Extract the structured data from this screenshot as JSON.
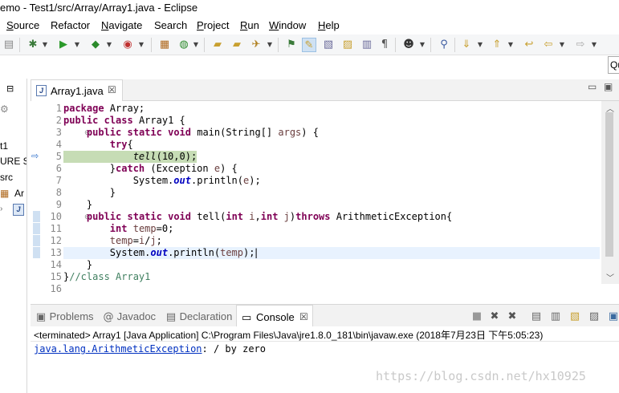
{
  "window": {
    "title": "emo - Test1/src/Array/Array1.java - Eclipse"
  },
  "menu": [
    {
      "mnemonic": "S",
      "rest": "ource"
    },
    {
      "mnemonic": "",
      "rest": "Refactor"
    },
    {
      "mnemonic": "N",
      "rest": "avigate"
    },
    {
      "mnemonic": "",
      "rest": "Search"
    },
    {
      "mnemonic": "P",
      "rest": "roject"
    },
    {
      "mnemonic": "R",
      "rest": "un"
    },
    {
      "mnemonic": "W",
      "rest": "indow"
    },
    {
      "mnemonic": "H",
      "rest": "elp"
    }
  ],
  "quick_access": {
    "label": "Qu"
  },
  "left_pane": {
    "items": [
      "t1",
      "URE S",
      "src",
      "Ar"
    ]
  },
  "editor": {
    "tab_label": "Array1.java",
    "tab_icon": "J",
    "close_glyph": "☒",
    "line_numbers": [
      "1",
      "2",
      "3",
      "4",
      "5",
      "6",
      "7",
      "8",
      "9",
      "10",
      "11",
      "12",
      "13",
      "14",
      "15",
      "16"
    ],
    "fold_marks": {
      "3": "⊖",
      "10": "⊖"
    },
    "lines": [
      [
        {
          "t": "package",
          "c": "kw"
        },
        {
          "t": " Array;"
        }
      ],
      [
        {
          "t": "public",
          "c": "kw"
        },
        {
          "t": " "
        },
        {
          "t": "class",
          "c": "kw"
        },
        {
          "t": " Array1 {"
        }
      ],
      [
        {
          "t": "    "
        },
        {
          "t": "public",
          "c": "kw"
        },
        {
          "t": " "
        },
        {
          "t": "static",
          "c": "kw"
        },
        {
          "t": " "
        },
        {
          "t": "void",
          "c": "kw"
        },
        {
          "t": " main(String[] "
        },
        {
          "t": "args",
          "c": "var"
        },
        {
          "t": ") {"
        }
      ],
      [
        {
          "t": "        "
        },
        {
          "t": "try",
          "c": "kw"
        },
        {
          "t": "{"
        }
      ],
      [
        {
          "t": "            "
        },
        {
          "t": "tell",
          "c": "it"
        },
        {
          "t": "(10,0);"
        }
      ],
      [
        {
          "t": "        }"
        },
        {
          "t": "catch",
          "c": "kw"
        },
        {
          "t": " (Exception "
        },
        {
          "t": "e",
          "c": "var"
        },
        {
          "t": ") {"
        }
      ],
      [
        {
          "t": "            System."
        },
        {
          "t": "out",
          "c": "fld"
        },
        {
          "t": ".println("
        },
        {
          "t": "e",
          "c": "var"
        },
        {
          "t": ");"
        }
      ],
      [
        {
          "t": "        }"
        }
      ],
      [
        {
          "t": "    }"
        }
      ],
      [
        {
          "t": "    "
        },
        {
          "t": "public",
          "c": "kw"
        },
        {
          "t": " "
        },
        {
          "t": "static",
          "c": "kw"
        },
        {
          "t": " "
        },
        {
          "t": "void",
          "c": "kw"
        },
        {
          "t": " tell("
        },
        {
          "t": "int",
          "c": "kw"
        },
        {
          "t": " "
        },
        {
          "t": "i",
          "c": "var"
        },
        {
          "t": ","
        },
        {
          "t": "int",
          "c": "kw"
        },
        {
          "t": " "
        },
        {
          "t": "j",
          "c": "var"
        },
        {
          "t": ")"
        },
        {
          "t": "throws",
          "c": "kw"
        },
        {
          "t": " ArithmeticException{"
        }
      ],
      [
        {
          "t": "        "
        },
        {
          "t": "int",
          "c": "kw"
        },
        {
          "t": " "
        },
        {
          "t": "temp",
          "c": "var"
        },
        {
          "t": "=0;"
        }
      ],
      [
        {
          "t": "        "
        },
        {
          "t": "temp",
          "c": "var"
        },
        {
          "t": "="
        },
        {
          "t": "i",
          "c": "var"
        },
        {
          "t": "/"
        },
        {
          "t": "j",
          "c": "var"
        },
        {
          "t": ";"
        }
      ],
      [
        {
          "t": "        System."
        },
        {
          "t": "out",
          "c": "fld"
        },
        {
          "t": ".println("
        },
        {
          "t": "temp",
          "c": "var"
        },
        {
          "t": ");"
        }
      ],
      [
        {
          "t": "    }"
        }
      ],
      [
        {
          "t": "}"
        },
        {
          "t": "//class Array1",
          "c": "cmt"
        }
      ],
      [
        {
          "t": ""
        }
      ]
    ],
    "current_line": 13,
    "debug_line": 5
  },
  "console_view": {
    "tabs": [
      {
        "icon": "▣",
        "label": "Problems"
      },
      {
        "icon": "@",
        "label": "Javadoc"
      },
      {
        "icon": "▤",
        "label": "Declaration"
      }
    ],
    "active_tab": {
      "icon": "▭",
      "label": "Console",
      "close_glyph": "☒"
    },
    "status": "<terminated> Array1 [Java Application] C:\\Program Files\\Java\\jre1.8.0_181\\bin\\javaw.exe (2018年7月23日 下午5:05:23)",
    "output_link": "java.lang.ArithmeticException",
    "output_rest": ": / by zero"
  },
  "watermark": "https://blog.csdn.net/hx10925",
  "colors": {
    "keyword": "#7f0055",
    "comment": "#3f7f5f",
    "field": "#0000c0",
    "local_var": "#6a3e3e",
    "current_line": "#e8f2fe",
    "debug_highlight": "#c6dcb5"
  }
}
